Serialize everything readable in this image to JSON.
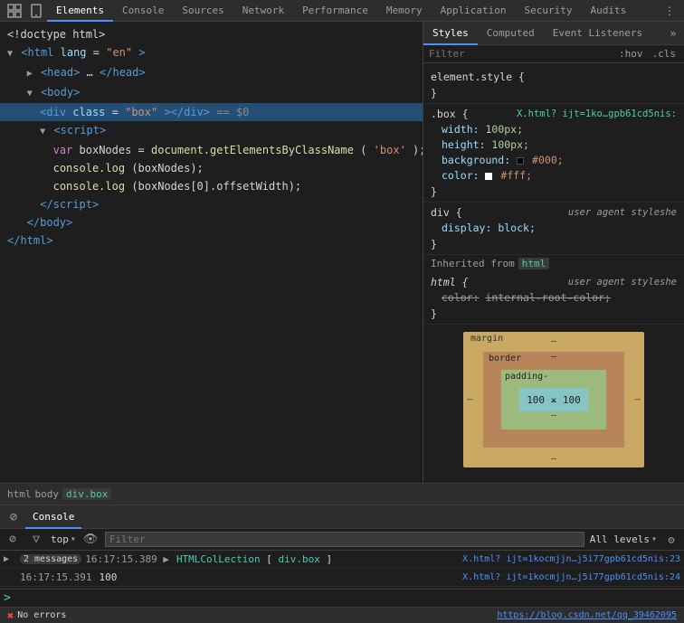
{
  "devtools": {
    "tabs": [
      {
        "label": "⬚",
        "type": "icon",
        "name": "inspect-icon"
      },
      {
        "label": "📱",
        "type": "icon",
        "name": "mobile-icon"
      },
      {
        "label": "Elements",
        "active": true
      },
      {
        "label": "Console"
      },
      {
        "label": "Sources"
      },
      {
        "label": "Network"
      },
      {
        "label": "Performance"
      },
      {
        "label": "Memory"
      },
      {
        "label": "Application"
      },
      {
        "label": "Security"
      },
      {
        "label": "Audits"
      }
    ]
  },
  "elements": {
    "lines": [
      {
        "indent": 0,
        "content": "<!doctype html>",
        "type": "plain"
      },
      {
        "indent": 0,
        "content": "",
        "type": "tag",
        "tag": "html",
        "attr": "lang",
        "attrVal": "\"en\""
      },
      {
        "indent": 1,
        "content": "",
        "type": "collapsed-tag",
        "tag": "head",
        "inner": "…</head>"
      },
      {
        "indent": 1,
        "content": "",
        "type": "tag-open",
        "tag": "body"
      },
      {
        "indent": 2,
        "content": "",
        "type": "selected-tag",
        "tag": "div",
        "attr": "class",
        "attrVal": "\"box\"",
        "extra": "></div>",
        "dollar": "== $0"
      },
      {
        "indent": 2,
        "content": "",
        "type": "tag-open",
        "tag": "script"
      },
      {
        "indent": 3,
        "content": "var boxNodes = document.getElementsByClassName('box');",
        "type": "code"
      },
      {
        "indent": 3,
        "content": "console.log(boxNodes);",
        "type": "code"
      },
      {
        "indent": 3,
        "content": "console.log(boxNodes[0].offsetWidth);",
        "type": "code"
      },
      {
        "indent": 2,
        "content": "",
        "type": "tag-close",
        "tag": "script"
      },
      {
        "indent": 1,
        "content": "",
        "type": "tag-close",
        "tag": "body"
      },
      {
        "indent": 0,
        "content": "",
        "type": "tag-close",
        "tag": "html"
      }
    ]
  },
  "styles": {
    "filter_placeholder": "Filter",
    "hov_btn": ":hov",
    "cls_btn": ".cls",
    "blocks": [
      {
        "selector": "element.style {",
        "close": "}",
        "source": "",
        "rules": []
      },
      {
        "selector": ".box {",
        "close": "}",
        "source": "X.html? ijt=1ko…gpb61cd5nis:",
        "rules": [
          {
            "prop": "width:",
            "val": "100px;",
            "type": "num"
          },
          {
            "prop": "height:",
            "val": "100px;",
            "type": "num"
          },
          {
            "prop": "background:",
            "val_parts": [
              {
                "type": "swatch",
                "color": "#000"
              },
              {
                "type": "text",
                "val": "#000;"
              }
            ],
            "type": "swatch"
          },
          {
            "prop": "color:",
            "val_parts": [
              {
                "type": "swatch",
                "color": "#fff"
              },
              {
                "type": "text",
                "val": "#fff;"
              }
            ],
            "type": "swatch"
          }
        ]
      },
      {
        "selector": "div {",
        "close": "}",
        "source_plain": "user agent styleshe",
        "rules": [
          {
            "prop": "display:",
            "val": "block;",
            "type": "plain"
          }
        ]
      },
      {
        "selector_inherited": "Inherited from",
        "inherited_tag": "html",
        "type": "inherited"
      },
      {
        "selector": "html {",
        "close": "}",
        "source_plain": "user agent styleshe",
        "rules": [
          {
            "prop": "color:",
            "val": "internal-root-color;",
            "type": "strikethrough"
          }
        ]
      }
    ]
  },
  "box_model": {
    "margin_label": "margin",
    "margin_dash": "–",
    "border_label": "border",
    "border_dash": "–",
    "padding_label": "padding-",
    "content_size": "100 × 100",
    "top_dash": "–",
    "bottom_dash": "–",
    "left_dash": "–",
    "right_dash": "–"
  },
  "breadcrumb": {
    "items": [
      {
        "label": "html",
        "active": false
      },
      {
        "label": "body",
        "active": false
      },
      {
        "label": "div.box",
        "active": true
      }
    ]
  },
  "console": {
    "tab_label": "Console",
    "toolbar": {
      "clear_icon": "🚫",
      "context": "top",
      "filter_placeholder": "Filter",
      "levels": "All levels"
    },
    "messages": [
      {
        "type": "info",
        "expand": true,
        "count": "2 messages",
        "text": "▶  HTMLColLection [div.box]",
        "text_parts": {
          "prefix": "▶ ",
          "link_blue": "HTMLColLection",
          "bracket_open": " [",
          "link_box": "div.box",
          "bracket_close": "]"
        },
        "timestamp": "16:17:15.389",
        "source": "X.html? ijt=1kocmjjn…j5i77gpb61cd5nis:23"
      },
      {
        "type": "info",
        "expand": false,
        "text": "100",
        "timestamp": "16:17:15.391",
        "source": "X.html? ijt=1kocmjjn…j5i77gpb61cd5nis:24"
      }
    ],
    "input_chevron": ">",
    "url": "https://blog.csdn.net/qq_39462095",
    "no_errors": "No errors"
  }
}
